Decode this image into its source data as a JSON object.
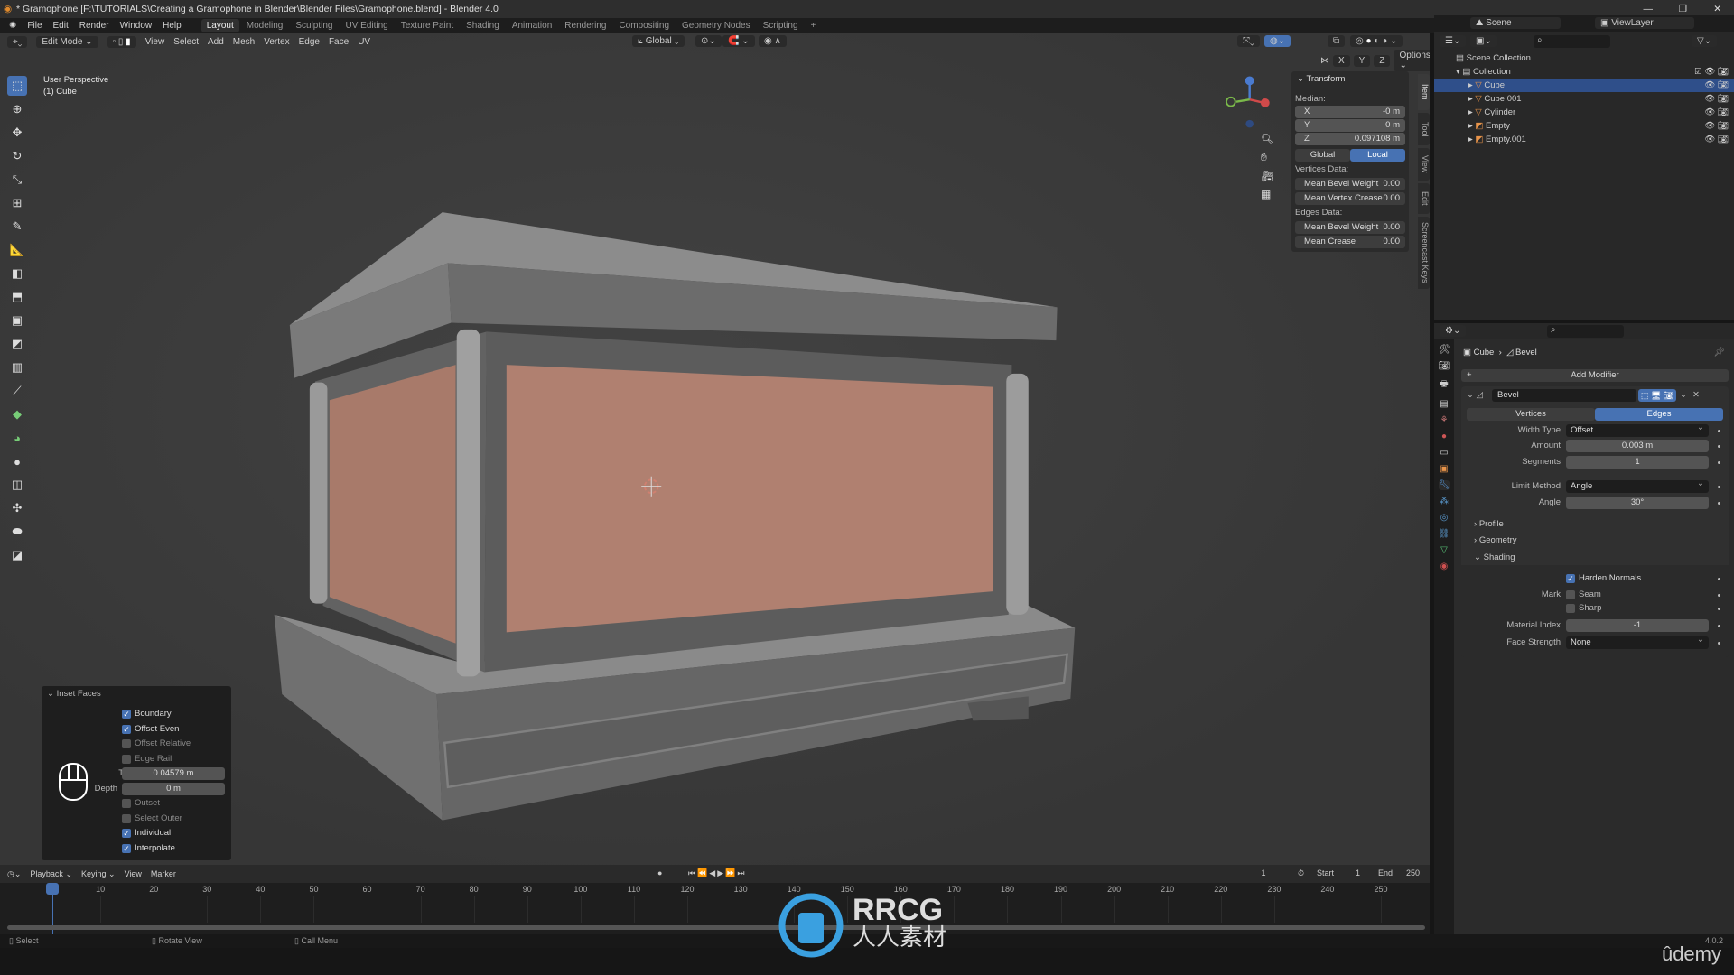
{
  "window": {
    "title": "* Gramophone [F:\\TUTORIALS\\Creating a Gramophone in Blender\\Blender Files\\Gramophone.blend] - Blender 4.0"
  },
  "topbar": {
    "menus": [
      "File",
      "Edit",
      "Render",
      "Window",
      "Help"
    ],
    "workspaces": [
      "Layout",
      "Modeling",
      "Sculpting",
      "UV Editing",
      "Texture Paint",
      "Shading",
      "Animation",
      "Rendering",
      "Compositing",
      "Geometry Nodes",
      "Scripting",
      "+"
    ],
    "active_workspace": "Layout"
  },
  "viewport_header": {
    "mode": "Edit Mode",
    "menus": [
      "View",
      "Select",
      "Add",
      "Mesh",
      "Vertex",
      "Edge",
      "Face",
      "UV"
    ],
    "orientation": "Global",
    "axes": [
      "X",
      "Y",
      "Z"
    ],
    "options": "Options"
  },
  "viewport": {
    "view_label": "User Perspective",
    "object_label": "(1) Cube",
    "accent_face": "#b08070"
  },
  "npanel": {
    "title": "Transform",
    "median": "Median:",
    "x_label": "X",
    "x_value": "-0 m",
    "y_label": "Y",
    "y_value": "0 m",
    "z_label": "Z",
    "z_value": "0.097108 m",
    "global": "Global",
    "local": "Local",
    "vertices_data": "Vertices Data:",
    "v_bevel_label": "Mean Bevel Weight",
    "v_bevel_value": "0.00",
    "v_crease_label": "Mean Vertex Crease",
    "v_crease_value": "0.00",
    "edges_data": "Edges Data:",
    "e_bevel_label": "Mean Bevel Weight",
    "e_bevel_value": "0.00",
    "e_crease_label": "Mean Crease",
    "e_crease_value": "0.00",
    "tabs": [
      "Item",
      "Tool",
      "View",
      "Edit",
      "Screencast Keys"
    ]
  },
  "operator": {
    "title": "Inset Faces",
    "boundary": {
      "label": "Boundary",
      "checked": true
    },
    "offset_even": {
      "label": "Offset Even",
      "checked": true
    },
    "offset_relative": {
      "label": "Offset Relative",
      "checked": false
    },
    "edge_rail": {
      "label": "Edge Rail",
      "checked": false
    },
    "thickness_label": "Thickness",
    "thickness_value": "0.04579 m",
    "depth_label": "Depth",
    "depth_value": "0 m",
    "outset": {
      "label": "Outset",
      "checked": false
    },
    "select_outer": {
      "label": "Select Outer",
      "checked": false
    },
    "individual": {
      "label": "Individual",
      "checked": true
    },
    "interpolate": {
      "label": "Interpolate",
      "checked": true
    }
  },
  "outliner": {
    "scene": "Scene",
    "view_layer": "ViewLayer",
    "root": "Scene Collection",
    "collection": "Collection",
    "items": [
      {
        "name": "Cube",
        "selected": true
      },
      {
        "name": "Cube.001",
        "selected": false
      },
      {
        "name": "Cylinder",
        "selected": false
      },
      {
        "name": "Empty",
        "selected": false
      },
      {
        "name": "Empty.001",
        "selected": false
      }
    ]
  },
  "properties": {
    "breadcrumb_object": "Cube",
    "breadcrumb_modifier": "Bevel",
    "add_modifier": "Add Modifier",
    "modifier_name": "Bevel",
    "tab_vertices": "Vertices",
    "tab_edges": "Edges",
    "width_type_label": "Width Type",
    "width_type_value": "Offset",
    "amount_label": "Amount",
    "amount_value": "0.003 m",
    "segments_label": "Segments",
    "segments_value": "1",
    "limit_method_label": "Limit Method",
    "limit_method_value": "Angle",
    "angle_label": "Angle",
    "angle_value": "30°",
    "profile": "Profile",
    "geometry": "Geometry",
    "shading": "Shading",
    "harden_normals": "Harden Normals",
    "mark_label": "Mark",
    "seam": "Seam",
    "sharp": "Sharp",
    "material_index_label": "Material Index",
    "material_index_value": "-1",
    "face_strength_label": "Face Strength",
    "face_strength_value": "None"
  },
  "timeline": {
    "menus": [
      "Playback",
      "Keying",
      "View",
      "Marker"
    ],
    "current_frame": "1",
    "start_label": "Start",
    "start": "1",
    "end_label": "End",
    "end": "250",
    "ticks": [
      "1",
      "10",
      "20",
      "30",
      "40",
      "50",
      "60",
      "70",
      "80",
      "90",
      "100",
      "110",
      "120",
      "130",
      "140",
      "150",
      "160",
      "170",
      "180",
      "190",
      "200",
      "210",
      "220",
      "230",
      "240",
      "250"
    ]
  },
  "status": {
    "select": "Select",
    "rotate": "Rotate View",
    "call_menu": "Call Menu",
    "version": "4.0.2"
  },
  "watermarks": {
    "rrcg": "RRCG",
    "rrcg_cn": "人人素材",
    "udemy": "ûdemy"
  },
  "colors": {
    "accent": "#4772b3",
    "selection": "#2f4f8a"
  }
}
